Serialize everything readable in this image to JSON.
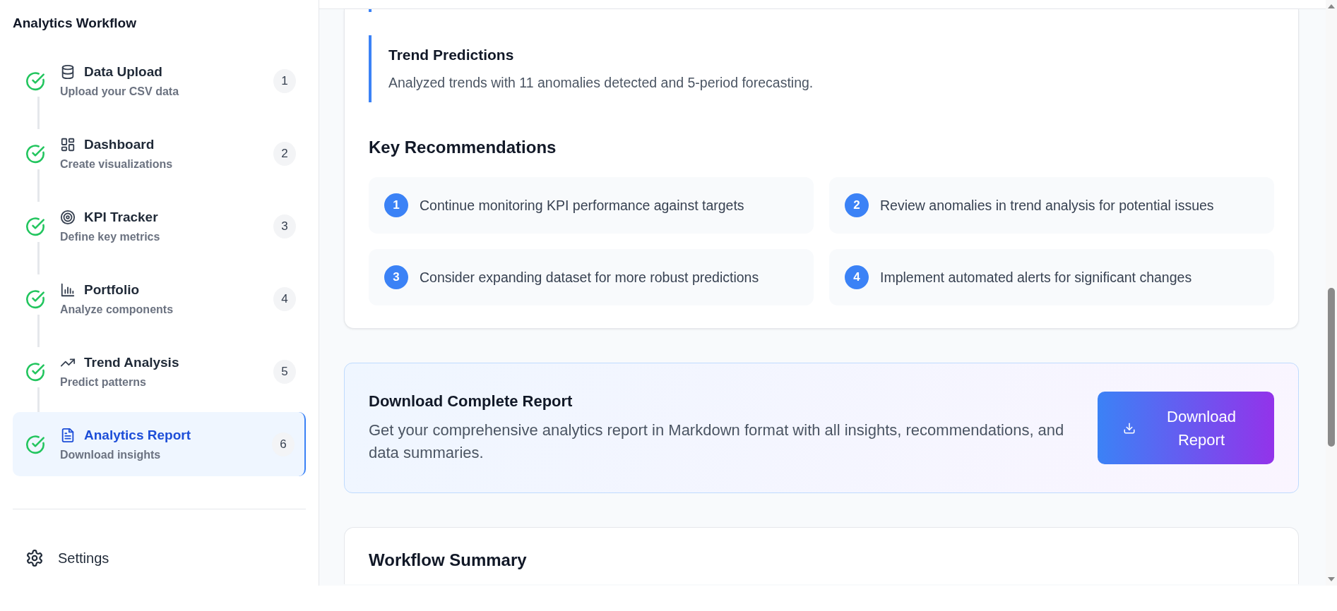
{
  "sidebar": {
    "title": "Analytics Workflow",
    "steps": [
      {
        "kind": "data",
        "title": "Data Upload",
        "subtitle": "Upload your CSV data",
        "number": "1",
        "completed": true,
        "selected": false
      },
      {
        "kind": "dashboard",
        "title": "Dashboard",
        "subtitle": "Create visualizations",
        "number": "2",
        "completed": true,
        "selected": false
      },
      {
        "kind": "kpi",
        "title": "KPI Tracker",
        "subtitle": "Define key metrics",
        "number": "3",
        "completed": true,
        "selected": false
      },
      {
        "kind": "portfolio",
        "title": "Portfolio",
        "subtitle": "Analyze components",
        "number": "4",
        "completed": true,
        "selected": false
      },
      {
        "kind": "trend",
        "title": "Trend Analysis",
        "subtitle": "Predict patterns",
        "number": "5",
        "completed": true,
        "selected": false
      },
      {
        "kind": "report",
        "title": "Analytics Report",
        "subtitle": "Download insights",
        "number": "6",
        "completed": true,
        "selected": true
      }
    ],
    "settings": {
      "label": "Settings"
    }
  },
  "insight": {
    "title": "Trend Predictions",
    "text": "Analyzed trends with 11 anomalies detected and 5-period forecasting."
  },
  "recommendations": {
    "title": "Key Recommendations",
    "items": [
      {
        "number": "1",
        "text": "Continue monitoring KPI performance against targets"
      },
      {
        "number": "2",
        "text": "Review anomalies in trend analysis for potential issues"
      },
      {
        "number": "3",
        "text": "Consider expanding dataset for more robust predictions"
      },
      {
        "number": "4",
        "text": "Implement automated alerts for significant changes"
      }
    ]
  },
  "download": {
    "title": "Download Complete Report",
    "text": "Get your comprehensive analytics report in Markdown format with all insights, recommendations, and data summaries.",
    "button": "Download Report"
  },
  "summary": {
    "title": "Workflow Summary"
  }
}
